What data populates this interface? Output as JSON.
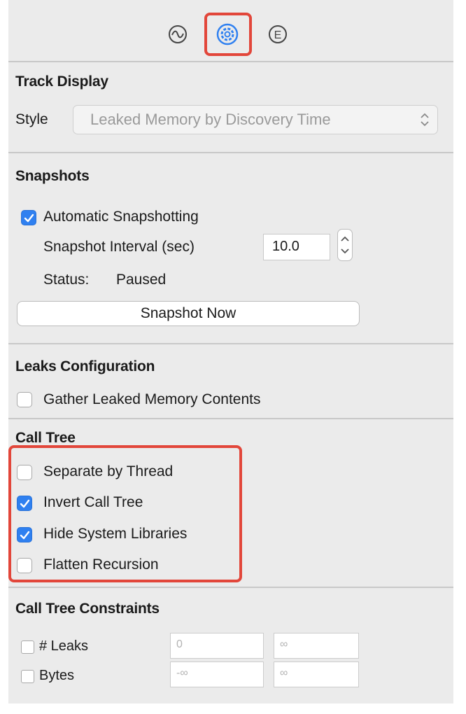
{
  "toolbar": {
    "icons": [
      "waveform-icon",
      "gear-icon",
      "extended-detail-icon"
    ],
    "e_glyph": "E",
    "selected": "gear-icon",
    "highlight_color": "#e2463a"
  },
  "track_display": {
    "title": "Track Display",
    "style_label": "Style",
    "style_value": "Leaked Memory by Discovery Time"
  },
  "snapshots": {
    "title": "Snapshots",
    "auto_label": "Automatic Snapshotting",
    "auto_checked": true,
    "interval_label": "Snapshot Interval (sec)",
    "interval_value": "10.0",
    "status_label": "Status:",
    "status_value": "Paused",
    "snapshot_now": "Snapshot Now"
  },
  "leaks_config": {
    "title": "Leaks Configuration",
    "gather_label": "Gather Leaked Memory Contents",
    "gather_checked": false
  },
  "call_tree": {
    "title": "Call Tree",
    "options": [
      {
        "label": "Separate by Thread",
        "checked": false
      },
      {
        "label": "Invert Call Tree",
        "checked": true
      },
      {
        "label": "Hide System Libraries",
        "checked": true
      },
      {
        "label": "Flatten Recursion",
        "checked": false
      }
    ]
  },
  "constraints": {
    "title": "Call Tree Constraints",
    "rows": [
      {
        "label": "# Leaks",
        "min": "0",
        "max": "∞",
        "checked": false
      },
      {
        "label": "Bytes",
        "min": "-∞",
        "max": "∞",
        "checked": false
      }
    ]
  },
  "colors": {
    "accent": "#2f80f0",
    "panel_bg": "#ebebeb",
    "annotation": "#e2463a"
  }
}
